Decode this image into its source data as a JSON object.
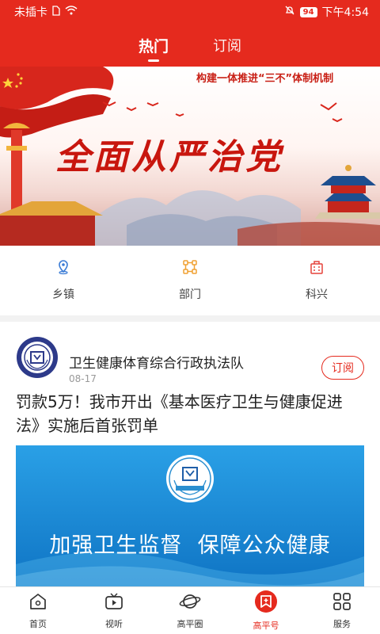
{
  "status_bar": {
    "carrier": "未插卡",
    "battery": "94",
    "time": "下午4:54"
  },
  "tabs": [
    {
      "label": "热门",
      "active": true
    },
    {
      "label": "订阅",
      "active": false
    }
  ],
  "banner": {
    "slogan_top": "构建一体推进“三不”体制机制",
    "headline": "全面从严治党"
  },
  "quick_nav": [
    {
      "label": "乡镇",
      "icon": "location-pin-icon"
    },
    {
      "label": "部门",
      "icon": "org-chart-icon"
    },
    {
      "label": "科兴",
      "icon": "building-icon"
    }
  ],
  "article": {
    "source_name": "卫生健康体育综合行政执法队",
    "date": "08-17",
    "subscribe_label": "订阅",
    "title": "罚款5万！我市开出《基本医疗卫生与健康促进法》实施后首张罚单",
    "cover_text": "加强卫生监督  保障公众健康"
  },
  "bottom_nav": [
    {
      "label": "首页",
      "icon": "home-icon",
      "active": false
    },
    {
      "label": "视听",
      "icon": "tv-icon",
      "active": false
    },
    {
      "label": "高平圈",
      "icon": "planet-icon",
      "active": false
    },
    {
      "label": "高平号",
      "icon": "bookmark-badge-icon",
      "active": true
    },
    {
      "label": "服务",
      "icon": "grid-icon",
      "active": false
    }
  ],
  "colors": {
    "brand_red": "#e52a1e",
    "cover_blue": "#1a8fd8"
  }
}
